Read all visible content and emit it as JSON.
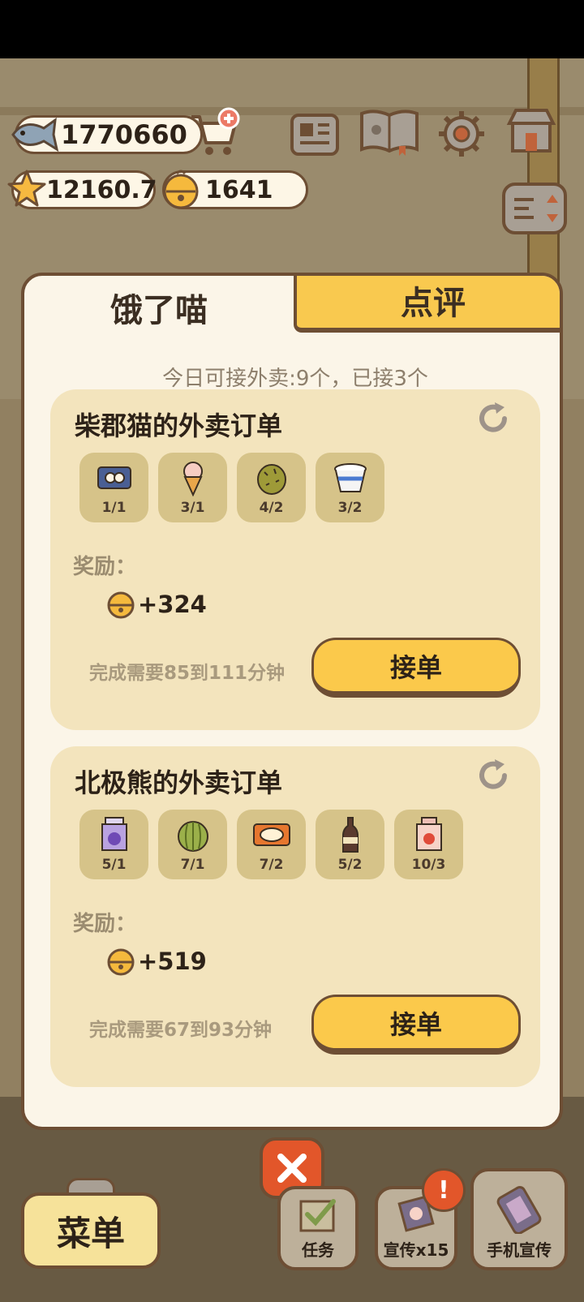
{
  "hud": {
    "fish": "1770660",
    "stars": "12160.7",
    "bells": "1641"
  },
  "tabs": {
    "active": "饿了喵",
    "inactive": "点评"
  },
  "quota_text": "今日可接外卖:9个，已接3个",
  "orders": [
    {
      "title": "柴郡猫的外卖订单",
      "items": [
        {
          "icon": "sushi-roll-icon",
          "count": "1/1"
        },
        {
          "icon": "ice-cream-cone-icon",
          "count": "3/1"
        },
        {
          "icon": "durian-icon",
          "count": "4/2"
        },
        {
          "icon": "yogurt-cup-icon",
          "count": "3/2"
        }
      ],
      "reward_label": "奖励：",
      "reward": "+324",
      "duration": "完成需要85到111分钟",
      "accept_label": "接单"
    },
    {
      "title": "北极熊的外卖订单",
      "items": [
        {
          "icon": "grape-drink-icon",
          "count": "5/1"
        },
        {
          "icon": "watermelon-icon",
          "count": "7/1"
        },
        {
          "icon": "fried-rice-icon",
          "count": "7/2"
        },
        {
          "icon": "cola-bottle-icon",
          "count": "5/2"
        },
        {
          "icon": "strawberry-drink-icon",
          "count": "10/3"
        }
      ],
      "reward_label": "奖励：",
      "reward": "+519",
      "duration": "完成需要67到93分钟",
      "accept_label": "接单"
    }
  ],
  "bottom": {
    "menu": "菜单",
    "task": "任务",
    "promo": "宣传x15",
    "phone_promo": "手机宣传",
    "alert": "!"
  },
  "colors": {
    "accent": "#fbc94b",
    "card": "#f3e4bd",
    "close": "#e2562a",
    "outline": "#6d4e34"
  }
}
